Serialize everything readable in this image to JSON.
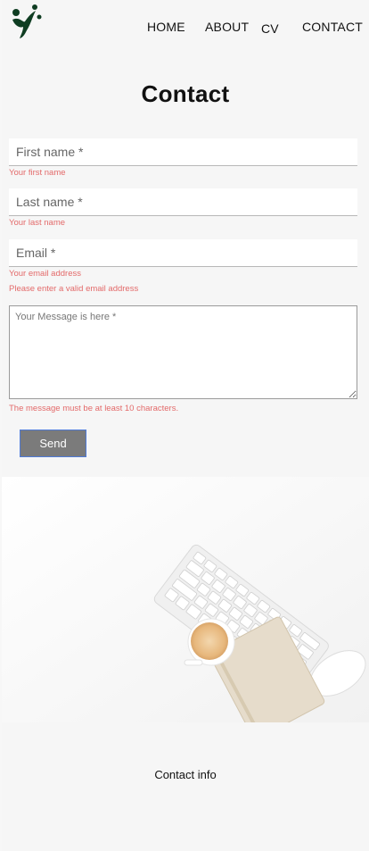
{
  "nav": {
    "items": [
      {
        "label": "HOME"
      },
      {
        "label": "ABOUT"
      },
      {
        "label": "CV"
      },
      {
        "label": "CONTACT"
      }
    ]
  },
  "page": {
    "title": "Contact"
  },
  "form": {
    "first_name": {
      "placeholder": "First name *",
      "value": "",
      "error": "Your first name"
    },
    "last_name": {
      "placeholder": "Last name *",
      "value": "",
      "error": "Your last name"
    },
    "email": {
      "placeholder": "Email *",
      "value": "",
      "error": "Your email address",
      "error2": "Please enter a valid email address"
    },
    "message": {
      "placeholder": "Your Message is here *",
      "value": "",
      "error": "The message must be at least 10 characters."
    },
    "send_label": "Send"
  },
  "footer": {
    "contact_info_label": "Contact info"
  },
  "colors": {
    "error": "#e36a6a",
    "button_bg": "#7b7b7b",
    "button_border": "#4f7bd8",
    "logo": "#0f3d22"
  }
}
